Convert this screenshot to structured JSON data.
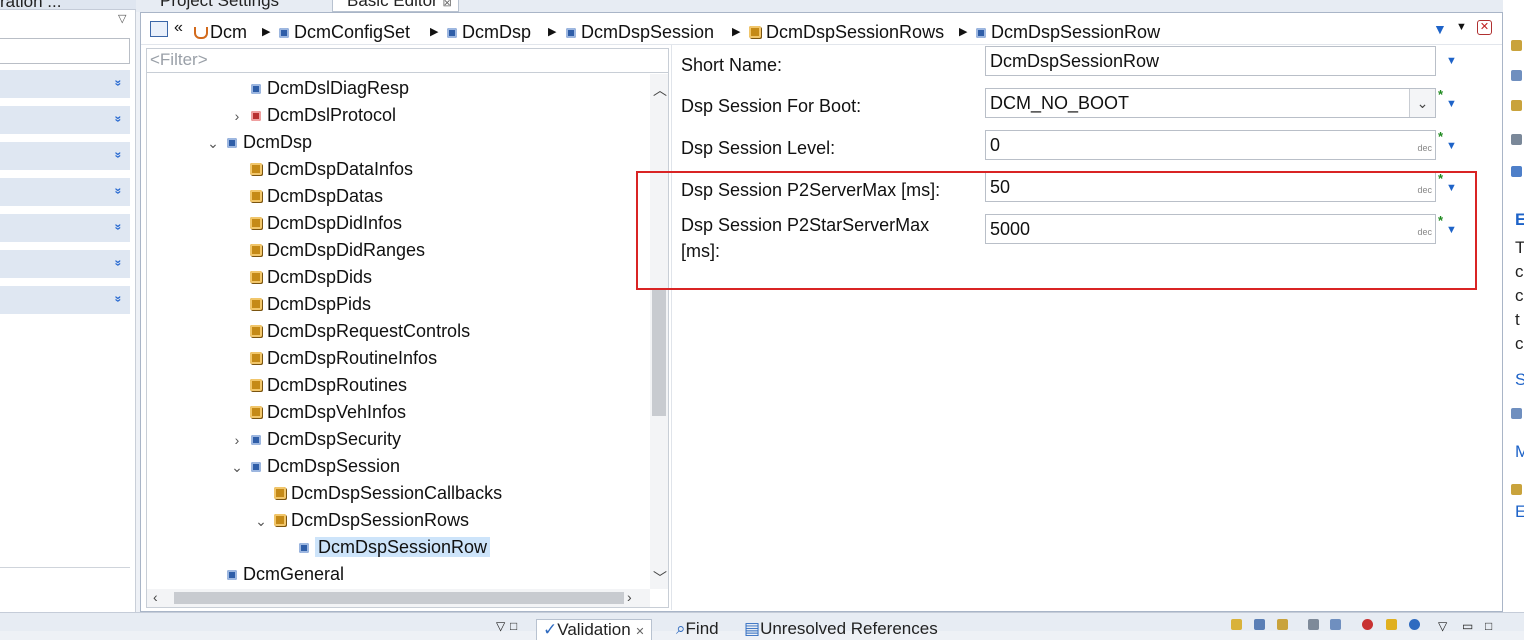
{
  "left_panel": {
    "tab_label": "ration ...",
    "menu_glyph": "▽"
  },
  "top_tabs": {
    "project_settings": "Project Settings",
    "basic_editor": "Basic Editor",
    "basic_editor_close": "⊠"
  },
  "breadcrumb": {
    "back_glyph": "«",
    "items": [
      "Dcm",
      "DcmConfigSet",
      "DcmDsp",
      "DcmDspSession",
      "DcmDspSessionRows",
      "DcmDspSessionRow"
    ]
  },
  "tree": {
    "filter_placeholder": "<Filter>",
    "nodes": [
      {
        "label": "DcmDslDiagResp"
      },
      {
        "label": "DcmDslProtocol"
      },
      {
        "label": "DcmDsp"
      },
      {
        "label": "DcmDspDataInfos"
      },
      {
        "label": "DcmDspDatas"
      },
      {
        "label": "DcmDspDidInfos"
      },
      {
        "label": "DcmDspDidRanges"
      },
      {
        "label": "DcmDspDids"
      },
      {
        "label": "DcmDspPids"
      },
      {
        "label": "DcmDspRequestControls"
      },
      {
        "label": "DcmDspRoutineInfos"
      },
      {
        "label": "DcmDspRoutines"
      },
      {
        "label": "DcmDspVehInfos"
      },
      {
        "label": "DcmDspSecurity"
      },
      {
        "label": "DcmDspSession"
      },
      {
        "label": "DcmDspSessionCallbacks"
      },
      {
        "label": "DcmDspSessionRows"
      },
      {
        "label": "DcmDspSessionRow"
      },
      {
        "label": "DcmGeneral"
      }
    ]
  },
  "form": {
    "short_name": {
      "label": "Short Name:",
      "value": "DcmDspSessionRow"
    },
    "boot": {
      "label": "Dsp Session For Boot:",
      "value": "DCM_NO_BOOT"
    },
    "level": {
      "label": "Dsp Session Level:",
      "value": "0",
      "unit": "dec"
    },
    "p2_server_max": {
      "label": "Dsp Session P2ServerMax [ms]:",
      "value": "50",
      "unit": "dec"
    },
    "p2_star_server_max": {
      "label_line1": "Dsp Session P2StarServerMax",
      "label_line2": "[ms]:",
      "value": "5000",
      "unit": "dec"
    },
    "required_marker": "*"
  },
  "bottom_tabs": {
    "validation": "Validation",
    "find": "Find",
    "unresolved": "Unresolved References"
  },
  "right_panel": {
    "letters": [
      "E",
      "T",
      "c",
      "c",
      "t",
      "c",
      "S",
      "M",
      "E"
    ]
  },
  "colors": {
    "accent_blue": "#1e63c8",
    "highlight_red": "#d92424",
    "selection": "#cde4fa",
    "required_green": "#1f8a1f"
  }
}
